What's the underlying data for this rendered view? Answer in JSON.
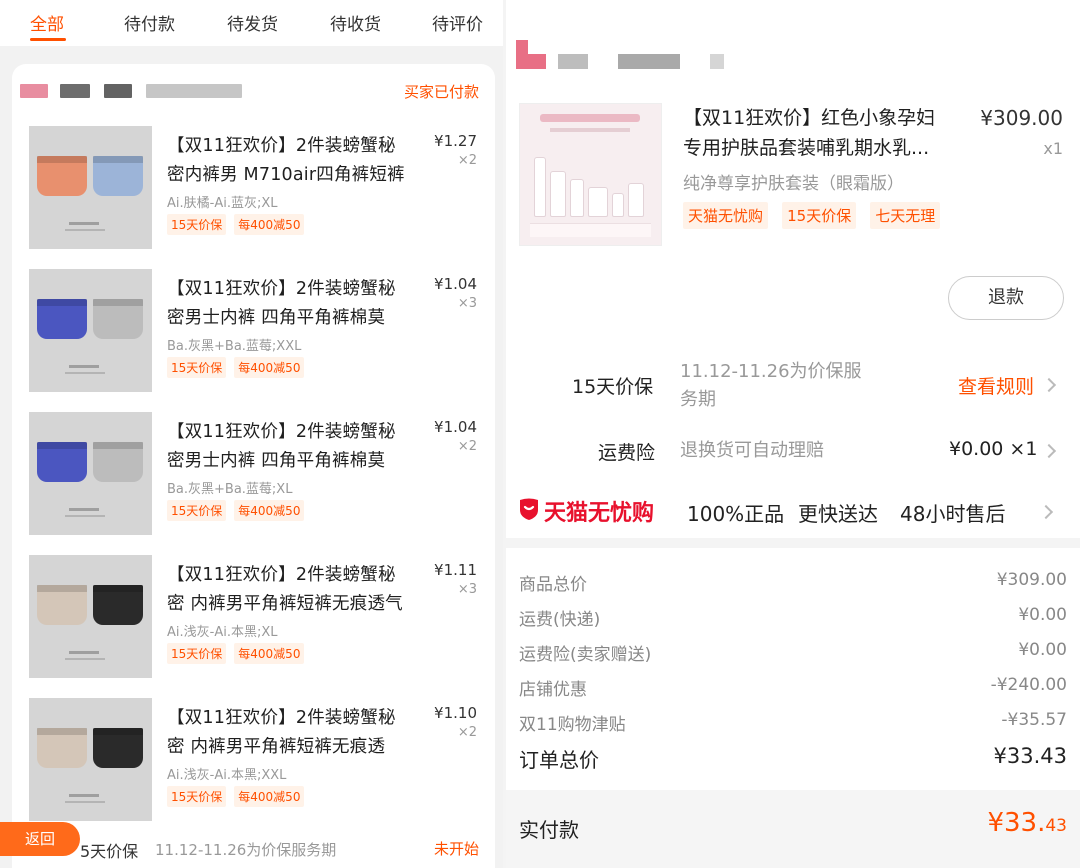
{
  "tabs": [
    "全部",
    "待付款",
    "待发货",
    "待收货",
    "待评价"
  ],
  "left_order": {
    "status": "买家已付款",
    "items": [
      {
        "title_l1": "【双11狂欢价】2件装螃蟹秘",
        "title_l2": "密内裤男 M710air四角裤短裤",
        "sku": "Ai.肤橘-Ai.蓝灰;XL",
        "price": "¥1.27",
        "qty": "×2",
        "tags": [
          "15天价保",
          "每400减50"
        ],
        "colors": [
          "#e8906e",
          "#9cb4d8"
        ]
      },
      {
        "title_l1": "【双11狂欢价】2件装螃蟹秘",
        "title_l2": "密男士内裤 四角平角裤棉莫",
        "sku": "Ba.灰黑+Ba.蓝莓;XXL",
        "price": "¥1.04",
        "qty": "×3",
        "tags": [
          "15天价保",
          "每400减50"
        ],
        "colors": [
          "#4b56c0",
          "#bcbcbc"
        ]
      },
      {
        "title_l1": "【双11狂欢价】2件装螃蟹秘",
        "title_l2": "密男士内裤 四角平角裤棉莫",
        "sku": "Ba.灰黑+Ba.蓝莓;XL",
        "price": "¥1.04",
        "qty": "×2",
        "tags": [
          "15天价保",
          "每400减50"
        ],
        "colors": [
          "#4b56c0",
          "#bcbcbc"
        ]
      },
      {
        "title_l1": "【双11狂欢价】2件装螃蟹秘",
        "title_l2": "密 内裤男平角裤短裤无痕透气",
        "sku": "Ai.浅灰-Ai.本黑;XL",
        "price": "¥1.11",
        "qty": "×3",
        "tags": [
          "15天价保",
          "每400减50"
        ],
        "colors": [
          "#d4c6b8",
          "#2a2a2a"
        ]
      },
      {
        "title_l1": "【双11狂欢价】2件装螃蟹秘",
        "title_l2": "密 内裤男平角裤短裤无痕透",
        "sku": "Ai.浅灰-Ai.本黑;XXL",
        "price": "¥1.10",
        "qty": "×2",
        "tags": [
          "15天价保",
          "每400减50"
        ],
        "colors": [
          "#d4c6b8",
          "#2a2a2a"
        ]
      }
    ],
    "price_protect": {
      "label": "5天价保",
      "period": "11.12-11.26为价保服务期",
      "state": "未开始"
    },
    "back_label": "返回"
  },
  "right_order": {
    "item": {
      "title_l1": "【双11狂欢价】红色小象孕妇",
      "title_l2": "专用护肤品套装哺乳期水乳...",
      "sku": "纯净尊享护肤套装（眼霜版）",
      "price": "¥309.00",
      "qty": "x1",
      "tags": [
        "天猫无忧购",
        "15天价保",
        "七天无理"
      ]
    },
    "refund_label": "退款",
    "price_protect": {
      "label": "15天价保",
      "period_l1": "11.12-11.26为价保服",
      "period_l2": "务期",
      "link": "查看规则"
    },
    "freight_ins": {
      "label": "运费险",
      "desc": "退换货可自动理赔",
      "value": "¥0.00 ×1"
    },
    "tmall": {
      "brand": "天猫无忧购",
      "features": [
        "100%正品",
        "更快送达",
        "48小时售后"
      ]
    },
    "summary": [
      {
        "k": "商品总价",
        "v": "¥309.00"
      },
      {
        "k": "运费(快递)",
        "v": "¥0.00"
      },
      {
        "k": "运费险(卖家赠送)",
        "v": "¥0.00"
      },
      {
        "k": "店铺优惠",
        "v": "-¥240.00"
      },
      {
        "k": "双11购物津贴",
        "v": "-¥35.57"
      }
    ],
    "order_total": {
      "k": "订单总价",
      "v": "¥33.43"
    },
    "paid": {
      "k": "实付款",
      "v_big": "¥33.",
      "v_small": "43"
    }
  }
}
